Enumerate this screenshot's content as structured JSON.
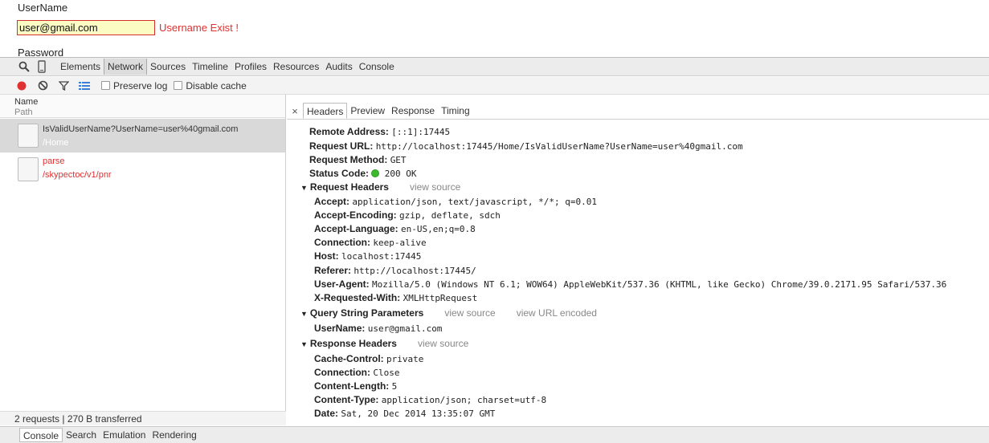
{
  "form": {
    "username_label": "UserName",
    "username_value": "user@gmail.com",
    "username_error": "Username Exist !",
    "password_label": "Password"
  },
  "devtools": {
    "tabs": [
      "Elements",
      "Network",
      "Sources",
      "Timeline",
      "Profiles",
      "Resources",
      "Audits",
      "Console"
    ],
    "active_tab": "Network"
  },
  "network": {
    "preserve_log_label": "Preserve log",
    "disable_cache_label": "Disable cache",
    "col_name": "Name",
    "col_path": "Path",
    "requests": [
      {
        "name": "IsValidUserName?UserName=user%40gmail.com",
        "path": "/Home"
      },
      {
        "name": "parse",
        "path": "/skypectoc/v1/pnr"
      }
    ],
    "status": "2 requests | 270 B transferred"
  },
  "detail": {
    "close": "×",
    "tabs": [
      "Headers",
      "Preview",
      "Response",
      "Timing"
    ],
    "general": [
      {
        "k": "Remote Address:",
        "v": "[::1]:17445"
      },
      {
        "k": "Request URL:",
        "v": "http://localhost:17445/Home/IsValidUserName?UserName=user%40gmail.com"
      },
      {
        "k": "Request Method:",
        "v": "GET"
      },
      {
        "k": "Status Code:",
        "v": "200 OK"
      }
    ],
    "request_headers_title": "Request Headers",
    "request_headers_link": "view source",
    "request_headers": [
      {
        "k": "Accept:",
        "v": "application/json, text/javascript, */*; q=0.01"
      },
      {
        "k": "Accept-Encoding:",
        "v": "gzip, deflate, sdch"
      },
      {
        "k": "Accept-Language:",
        "v": "en-US,en;q=0.8"
      },
      {
        "k": "Connection:",
        "v": "keep-alive"
      },
      {
        "k": "Host:",
        "v": "localhost:17445"
      },
      {
        "k": "Referer:",
        "v": "http://localhost:17445/"
      },
      {
        "k": "User-Agent:",
        "v": "Mozilla/5.0 (Windows NT 6.1; WOW64) AppleWebKit/537.36 (KHTML, like Gecko) Chrome/39.0.2171.95 Safari/537.36"
      },
      {
        "k": "X-Requested-With:",
        "v": "XMLHttpRequest"
      }
    ],
    "query_title": "Query String Parameters",
    "query_link1": "view source",
    "query_link2": "view URL encoded",
    "query_params": [
      {
        "k": "UserName:",
        "v": "user@gmail.com"
      }
    ],
    "response_headers_title": "Response Headers",
    "response_headers_link": "view source",
    "response_headers": [
      {
        "k": "Cache-Control:",
        "v": "private"
      },
      {
        "k": "Connection:",
        "v": "Close"
      },
      {
        "k": "Content-Length:",
        "v": "5"
      },
      {
        "k": "Content-Type:",
        "v": "application/json; charset=utf-8"
      },
      {
        "k": "Date:",
        "v": "Sat, 20 Dec 2014 13:35:07 GMT"
      }
    ]
  },
  "drawer": {
    "tabs": [
      "Console",
      "Search",
      "Emulation",
      "Rendering"
    ]
  }
}
